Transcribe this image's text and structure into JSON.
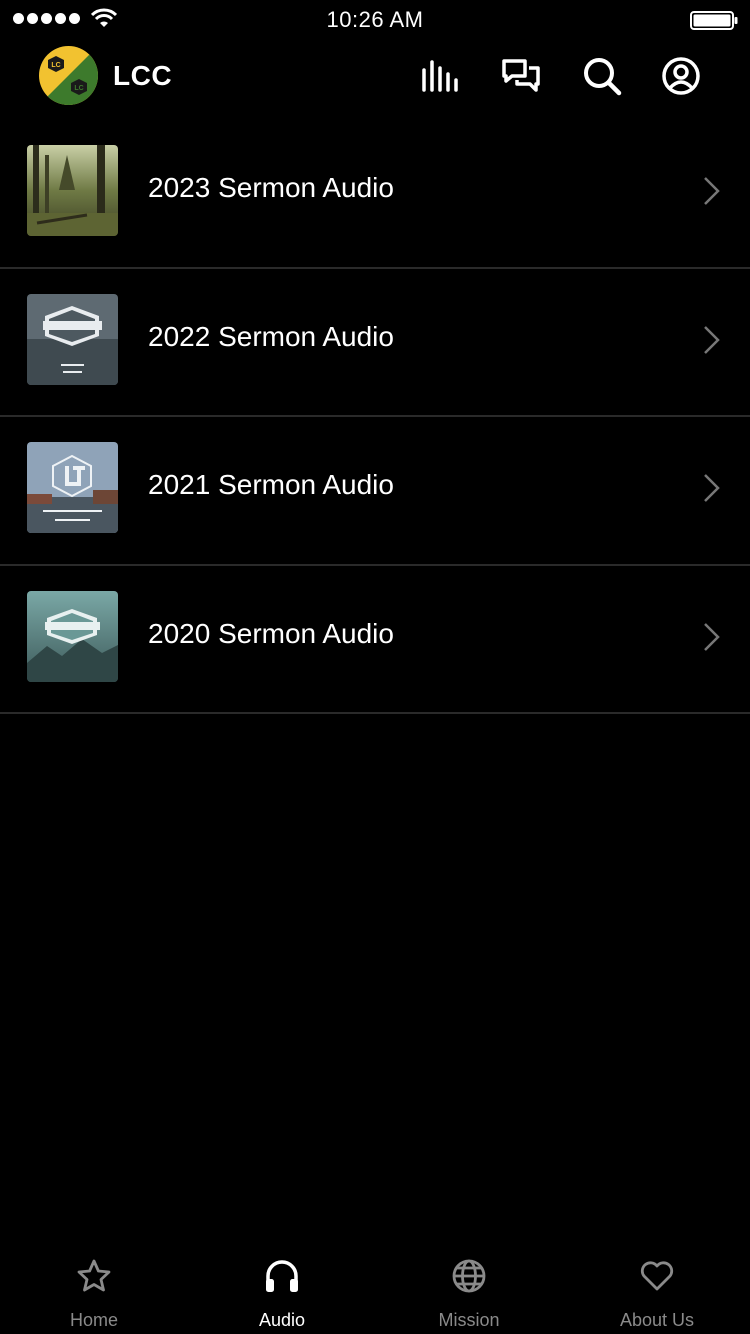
{
  "status_bar": {
    "time": "10:26 AM"
  },
  "header": {
    "title": "LCC"
  },
  "items": [
    {
      "title": "2023 Sermon Audio"
    },
    {
      "title": "2022 Sermon Audio"
    },
    {
      "title": "2021 Sermon Audio"
    },
    {
      "title": "2020 Sermon Audio"
    }
  ],
  "tabs": [
    {
      "label": "Home",
      "icon": "star-icon"
    },
    {
      "label": "Audio",
      "icon": "headphones-icon",
      "active": true
    },
    {
      "label": "Mission",
      "icon": "globe-icon"
    },
    {
      "label": "About Us",
      "icon": "heart-icon"
    }
  ],
  "colors": {
    "background": "#000000",
    "inactive": "#8a8a8a",
    "active": "#ffffff",
    "logo_yellow": "#f2c230",
    "logo_green": "#3d7a2c"
  }
}
